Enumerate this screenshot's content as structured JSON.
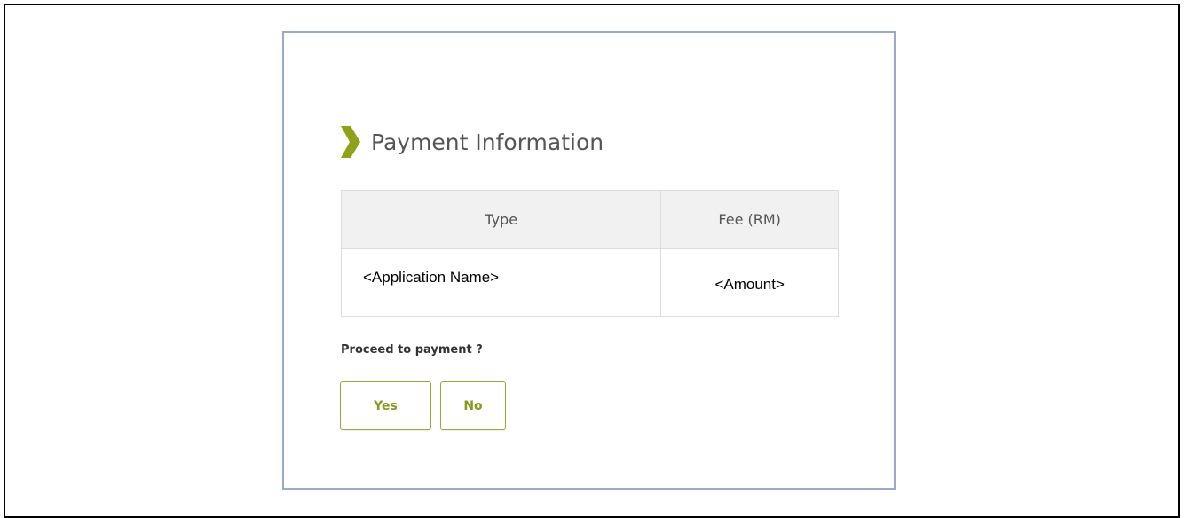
{
  "colors": {
    "accent": "#849a1a",
    "chevron": "#8fa118",
    "dialog_border": "#98abcf",
    "table_header_bg": "#f1f1f1",
    "table_border": "#dddddd"
  },
  "dialog": {
    "header": {
      "icon": "chevron-right-icon",
      "title": "Payment Information"
    },
    "table": {
      "columns": [
        "Type",
        "Fee (RM)"
      ],
      "rows": [
        [
          "<Application Name>",
          "<Amount>"
        ]
      ]
    },
    "prompt": "Proceed to payment ?",
    "buttons": {
      "yes_label": "Yes",
      "no_label": "No"
    }
  }
}
